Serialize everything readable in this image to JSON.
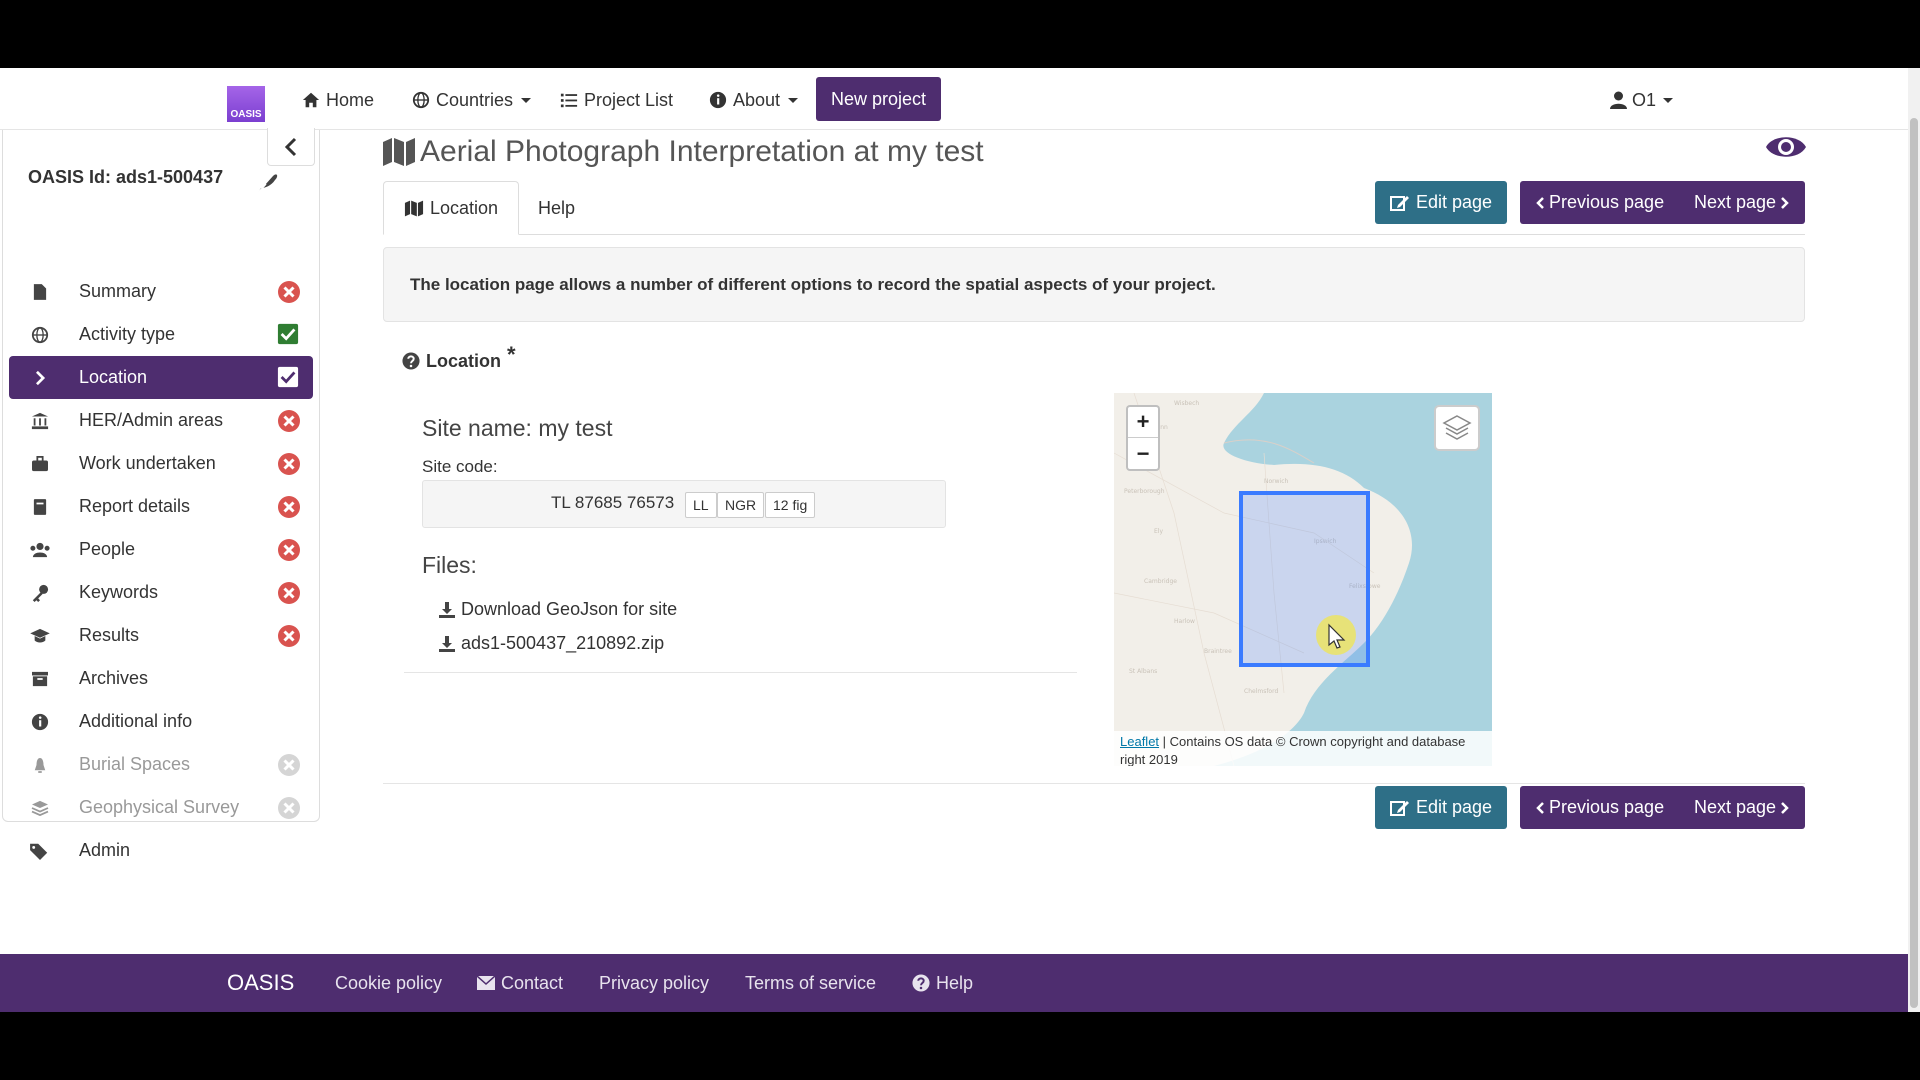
{
  "navbar": {
    "brand": "OASIS",
    "home": "Home",
    "countries": "Countries",
    "project_list": "Project List",
    "about": "About",
    "new_project": "New project",
    "user": "O1"
  },
  "sidebar": {
    "oasis_id": "OASIS Id: ads1-500437",
    "items": [
      {
        "label": "Summary",
        "icon": "file-icon",
        "status": "incomplete"
      },
      {
        "label": "Activity type",
        "icon": "globe-icon",
        "status": "complete"
      },
      {
        "label": "Location",
        "icon": "chevron-right-icon",
        "status": "complete",
        "active": true
      },
      {
        "label": "HER/Admin areas",
        "icon": "institution-icon",
        "status": "incomplete"
      },
      {
        "label": "Work undertaken",
        "icon": "briefcase-icon",
        "status": "incomplete"
      },
      {
        "label": "Report details",
        "icon": "book-icon",
        "status": "incomplete"
      },
      {
        "label": "People",
        "icon": "users-icon",
        "status": "incomplete"
      },
      {
        "label": "Keywords",
        "icon": "key-icon",
        "status": "incomplete"
      },
      {
        "label": "Results",
        "icon": "graduation-cap-icon",
        "status": "incomplete"
      },
      {
        "label": "Archives",
        "icon": "archive-icon",
        "status": "none"
      },
      {
        "label": "Additional info",
        "icon": "info-circle-icon",
        "status": "none"
      },
      {
        "label": "Burial Spaces",
        "icon": "bell-icon",
        "status": "disabled"
      },
      {
        "label": "Geophysical Survey",
        "icon": "layers-icon",
        "status": "disabled"
      },
      {
        "label": "Admin",
        "icon": "tags-icon",
        "status": "none"
      }
    ]
  },
  "main": {
    "title": "Aerial Photograph Interpretation at my test",
    "tabs": [
      {
        "label": "Location"
      },
      {
        "label": "Help"
      }
    ],
    "edit_page": "Edit page",
    "previous_page": "Previous page",
    "next_page": "Next page",
    "info": "The location page allows a number of different options to record the spatial aspects of your project.",
    "location_label": "Location",
    "required_mark": "*",
    "site_name": "Site name: my test",
    "site_code_label": "Site code:",
    "site_code_value": "TL 87685 76573",
    "coord_buttons": [
      "LL",
      "NGR",
      "12 fig"
    ],
    "files_label": "Files:",
    "files": [
      "Download GeoJson for site",
      "ads1-500437_210892.zip"
    ]
  },
  "map": {
    "zoom_in": "+",
    "zoom_out": "−",
    "attribution_link": "Leaflet",
    "attribution_text": " | Contains OS data © Crown copyright and database right 2019",
    "highlight_color": "#3a7bff"
  },
  "footer": {
    "brand": "OASIS",
    "cookie": "Cookie policy",
    "contact": "Contact",
    "privacy": "Privacy policy",
    "terms": "Terms of service",
    "help": "Help"
  },
  "colors": {
    "primary": "#4e2d6f",
    "edit": "#2e6f87",
    "incomplete": "#d9534f",
    "complete": "#2f7d32"
  }
}
